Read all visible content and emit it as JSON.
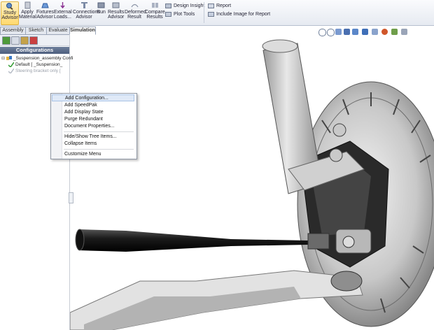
{
  "ribbon": {
    "buttons": [
      {
        "name": "study-advisor",
        "label": "Study\nAdvisor",
        "icon": "study-advisor-icon"
      },
      {
        "name": "apply-material",
        "label": "Apply\nMaterial",
        "icon": "material-icon"
      },
      {
        "name": "fixtures-advisor",
        "label": "Fixtures\nAdvisor",
        "icon": "fixtures-icon"
      },
      {
        "name": "external-loads",
        "label": "External\nLoads...",
        "icon": "loads-icon"
      },
      {
        "name": "connections-advisor",
        "label": "Connections\nAdvisor",
        "icon": "connections-icon"
      },
      {
        "name": "run",
        "label": "Run",
        "icon": "run-icon"
      },
      {
        "name": "results-advisor",
        "label": "Results\nAdvisor",
        "icon": "results-icon"
      },
      {
        "name": "deformed-result",
        "label": "Deformed\nResult",
        "icon": "deformed-icon"
      },
      {
        "name": "compare-results",
        "label": "Compare\nResults",
        "icon": "compare-icon"
      }
    ],
    "small": {
      "design_insight": "Design Insight",
      "plot_tools": "Plot Tools",
      "report": "Report",
      "include_image": "Include Image for Report"
    }
  },
  "tabs": [
    "Assembly",
    "Sketch",
    "Evaluate",
    "Simulation"
  ],
  "active_tab": "Simulation",
  "panel": {
    "header": "Configurations",
    "tree": [
      "_Suspension_assembly Confi",
      "Default [ _Suspension_",
      "Steering bracket only ["
    ]
  },
  "context_menu": {
    "items": [
      "Add Configuration...",
      "Add SpeedPak",
      "Add Display State",
      "Purge Redundant",
      "Document Properties...",
      "Hide/Show Tree Items...",
      "Collapse Items",
      "Customize Menu"
    ]
  },
  "colors": {
    "ribbon_active": "#ffd96e",
    "panel_header": "#5a6b8a",
    "menu_highlight": "#dfe9f7"
  }
}
